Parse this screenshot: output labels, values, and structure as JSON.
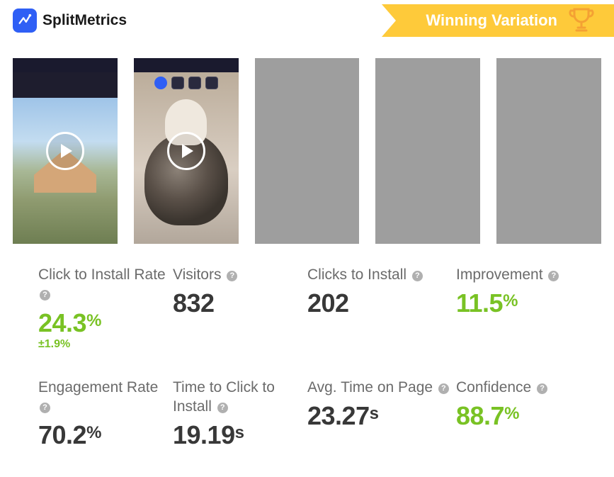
{
  "brand": {
    "name": "SplitMetrics"
  },
  "ribbon": {
    "label": "Winning Variation"
  },
  "thumbnails": [
    {
      "kind": "video",
      "has_play": true
    },
    {
      "kind": "video",
      "has_play": true
    },
    {
      "kind": "placeholder",
      "has_play": false
    },
    {
      "kind": "placeholder",
      "has_play": false
    },
    {
      "kind": "placeholder",
      "has_play": false
    }
  ],
  "metrics": {
    "click_to_install_rate": {
      "label": "Click to Install Rate",
      "value": "24.3",
      "unit": "%",
      "margin": "±1.9%",
      "color": "green"
    },
    "visitors": {
      "label": "Visitors",
      "value": "832",
      "unit": "",
      "color": "dark"
    },
    "clicks_to_install": {
      "label": "Clicks to Install",
      "value": "202",
      "unit": "",
      "color": "dark"
    },
    "improvement": {
      "label": "Improvement",
      "value": "11.5",
      "unit": "%",
      "color": "green"
    },
    "engagement_rate": {
      "label": "Engagement Rate",
      "value": "70.2",
      "unit": "%",
      "color": "dark"
    },
    "time_to_click_install": {
      "label": "Time to Click to Install",
      "value": "19.19",
      "unit": "s",
      "color": "dark"
    },
    "avg_time_on_page": {
      "label": "Avg. Time on Page",
      "value": "23.27",
      "unit": "s",
      "color": "dark"
    },
    "confidence": {
      "label": "Confidence",
      "value": "88.7",
      "unit": "%",
      "color": "green"
    }
  }
}
